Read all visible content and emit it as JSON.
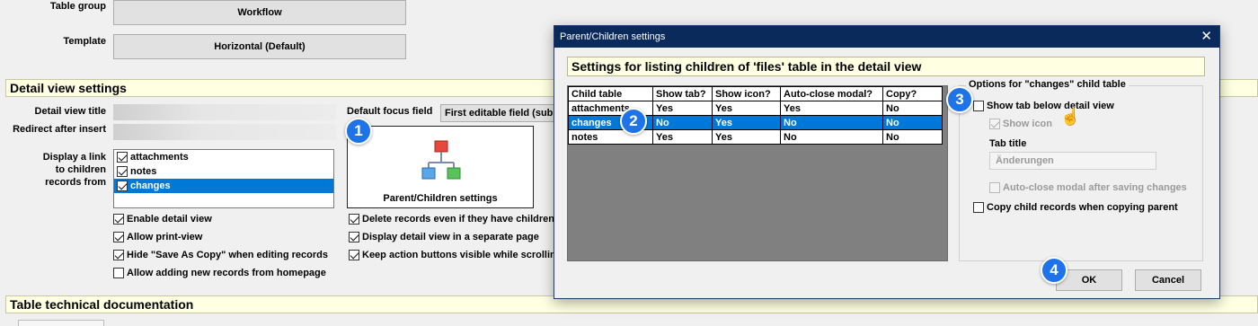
{
  "form": {
    "table_group": {
      "label": "Table group",
      "value": "Workflow"
    },
    "template": {
      "label": "Template",
      "value": "Horizontal (Default)"
    },
    "detail_section": "Detail view settings",
    "detail_view_title_label": "Detail view title",
    "redirect_label": "Redirect after insert",
    "display_link_label": [
      "Display a link",
      "to children",
      "records from"
    ],
    "children_list": [
      {
        "label": "attachments",
        "checked": true,
        "selected": false
      },
      {
        "label": "notes",
        "checked": true,
        "selected": false
      },
      {
        "label": "changes",
        "checked": true,
        "selected": true
      }
    ],
    "default_focus_label": "Default focus field",
    "default_focus_value": "First editable field (sub",
    "parent_children_button": "Parent/Children settings",
    "checks_left": [
      {
        "label": "Enable detail view",
        "checked": true
      },
      {
        "label": "Allow print-view",
        "checked": true
      },
      {
        "label": "Hide \"Save As Copy\" when editing records",
        "checked": true
      },
      {
        "label": "Allow adding new records from homepage",
        "checked": false
      }
    ],
    "checks_right": [
      {
        "label": "Delete records even if they have children",
        "checked": true
      },
      {
        "label": "Display detail view in a separate page",
        "checked": true
      },
      {
        "label": "Keep action buttons visible while scrollin",
        "checked": true
      }
    ],
    "tech_section": "Table technical documentation"
  },
  "dialog": {
    "title": "Parent/Children settings",
    "close_glyph": "✕",
    "heading": "Settings for listing children of 'files' table in the detail view",
    "columns": [
      "Child table",
      "Show tab?",
      "Show icon?",
      "Auto-close modal?",
      "Copy?"
    ],
    "rows": [
      {
        "cells": [
          "attachments",
          "Yes",
          "Yes",
          "Yes",
          "No"
        ],
        "selected": false
      },
      {
        "cells": [
          "changes",
          "No",
          "Yes",
          "No",
          "No"
        ],
        "selected": true
      },
      {
        "cells": [
          "notes",
          "Yes",
          "Yes",
          "No",
          "No"
        ],
        "selected": false
      }
    ],
    "options": {
      "title": "Options for \"changes\" child table",
      "show_tab": {
        "label": "Show tab below detail view",
        "checked": false
      },
      "show_icon": {
        "label": "Show icon",
        "checked": true,
        "disabled": true
      },
      "tab_title_label": "Tab title",
      "tab_title_value": "Änderungen",
      "auto_close": {
        "label": "Auto-close modal after saving changes",
        "checked": false,
        "disabled": true
      },
      "copy_child": {
        "label": "Copy child records when copying parent",
        "checked": false
      }
    },
    "ok": "OK",
    "cancel": "Cancel"
  },
  "badges": [
    "1",
    "2",
    "3",
    "4"
  ],
  "colors": {
    "badge": "#1e73e8",
    "selection": "#0078d7",
    "section_bg": "#ffffe1",
    "titlebar": "#0b2a5c"
  },
  "icons": {
    "parent_children": "hierarchy-icon",
    "cursor": "hand-cursor-icon"
  }
}
